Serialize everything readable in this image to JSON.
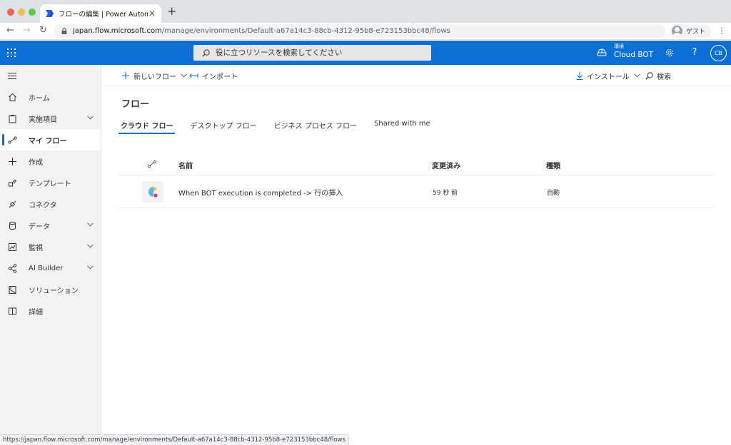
{
  "browser": {
    "tab_title": "フローの編集 | Power Automate",
    "tab_close": "✕",
    "new_tab": "+",
    "url_host": "japan.flow.microsoft.com",
    "url_path": "/manage/environments/Default-a67a14c3-88cb-4312-95b8-e723153bbc48/flows",
    "profile_label": "ゲスト",
    "status_url": "https://japan.flow.microsoft.com/manage/environments/Default-a67a14c3-88cb-4312-95b8-e723153bbc48/flows"
  },
  "header": {
    "search_placeholder": "役に立つリソースを検索してください",
    "environment_label": "環境",
    "environment_name": "Cloud BOT",
    "help": "?",
    "user_initials": "CB",
    "brand_color": "#0b6fd3"
  },
  "sidebar": {
    "items": [
      {
        "label": "ホーム",
        "icon": "home-icon"
      },
      {
        "label": "実施項目",
        "icon": "clipboard-icon",
        "expandable": true
      },
      {
        "label": "マイ フロー",
        "icon": "flow-icon",
        "active": true
      },
      {
        "label": "作成",
        "icon": "plus-icon"
      },
      {
        "label": "テンプレート",
        "icon": "template-icon"
      },
      {
        "label": "コネクタ",
        "icon": "connector-icon"
      },
      {
        "label": "データ",
        "icon": "database-icon",
        "expandable": true
      },
      {
        "label": "監視",
        "icon": "monitor-icon",
        "expandable": true
      },
      {
        "label": "AI Builder",
        "icon": "ai-builder-icon",
        "expandable": true
      },
      {
        "label": "ソリューション",
        "icon": "solution-icon"
      },
      {
        "label": "詳細",
        "icon": "book-icon"
      }
    ]
  },
  "commandbar": {
    "new_flow": "新しいフロー",
    "import": "インポート",
    "install": "インストール",
    "search": "検索"
  },
  "main": {
    "title": "フロー",
    "tabs": [
      {
        "label": "クラウド フロー",
        "active": true
      },
      {
        "label": "デスクトップ フロー"
      },
      {
        "label": "ビジネス プロセス フロー"
      },
      {
        "label": "Shared with me"
      }
    ],
    "table": {
      "columns": {
        "name": "名前",
        "modified": "変更済み",
        "type": "種類"
      },
      "rows": [
        {
          "name": "When BOT execution is completed -> 行の挿入",
          "modified": "59 秒 前",
          "type": "自動"
        }
      ]
    }
  }
}
